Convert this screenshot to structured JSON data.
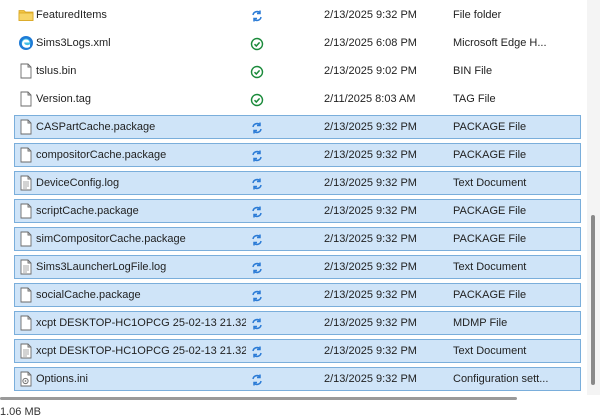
{
  "files": [
    {
      "name": "FeaturedItems",
      "status": "sync",
      "date": "2/13/2025 9:32 PM",
      "type": "File folder",
      "icon": "folder-icon",
      "selected": false
    },
    {
      "name": "Sims3Logs.xml",
      "status": "ok",
      "date": "2/13/2025 6:08 PM",
      "type": "Microsoft Edge H...",
      "icon": "edge-icon",
      "selected": false
    },
    {
      "name": "tslus.bin",
      "status": "ok",
      "date": "2/13/2025 9:02 PM",
      "type": "BIN File",
      "icon": "file-icon",
      "selected": false
    },
    {
      "name": "Version.tag",
      "status": "ok",
      "date": "2/11/2025 8:03 AM",
      "type": "TAG File",
      "icon": "file-icon",
      "selected": false
    },
    {
      "name": "CASPartCache.package",
      "status": "sync",
      "date": "2/13/2025 9:32 PM",
      "type": "PACKAGE File",
      "icon": "file-icon",
      "selected": true
    },
    {
      "name": "compositorCache.package",
      "status": "sync",
      "date": "2/13/2025 9:32 PM",
      "type": "PACKAGE File",
      "icon": "file-icon",
      "selected": true
    },
    {
      "name": "DeviceConfig.log",
      "status": "sync",
      "date": "2/13/2025 9:32 PM",
      "type": "Text Document",
      "icon": "text-file-icon",
      "selected": true
    },
    {
      "name": "scriptCache.package",
      "status": "sync",
      "date": "2/13/2025 9:32 PM",
      "type": "PACKAGE File",
      "icon": "file-icon",
      "selected": true
    },
    {
      "name": "simCompositorCache.package",
      "status": "sync",
      "date": "2/13/2025 9:32 PM",
      "type": "PACKAGE File",
      "icon": "file-icon",
      "selected": true
    },
    {
      "name": "Sims3LauncherLogFile.log",
      "status": "sync",
      "date": "2/13/2025 9:32 PM",
      "type": "Text Document",
      "icon": "text-file-icon",
      "selected": true
    },
    {
      "name": "socialCache.package",
      "status": "sync",
      "date": "2/13/2025 9:32 PM",
      "type": "PACKAGE File",
      "icon": "file-icon",
      "selected": true
    },
    {
      "name": "xcpt DESKTOP-HC1OPCG 25-02-13 21.32....",
      "status": "sync",
      "date": "2/13/2025 9:32 PM",
      "type": "MDMP File",
      "icon": "file-icon",
      "selected": true
    },
    {
      "name": "xcpt DESKTOP-HC1OPCG 25-02-13 21.32....",
      "status": "sync",
      "date": "2/13/2025 9:32 PM",
      "type": "Text Document",
      "icon": "text-file-icon",
      "selected": true
    },
    {
      "name": "Options.ini",
      "status": "sync",
      "date": "2/13/2025 9:32 PM",
      "type": "Configuration sett...",
      "icon": "settings-file-icon",
      "selected": true
    }
  ],
  "status_bar": {
    "text": "1.06 MB"
  },
  "colors": {
    "selection_bg": "#cfe4f8",
    "selection_border": "#7aaedb",
    "ok_green": "#1a8a3a",
    "sync_blue": "#2b7bd6",
    "folder_yellow": "#f2c444"
  }
}
